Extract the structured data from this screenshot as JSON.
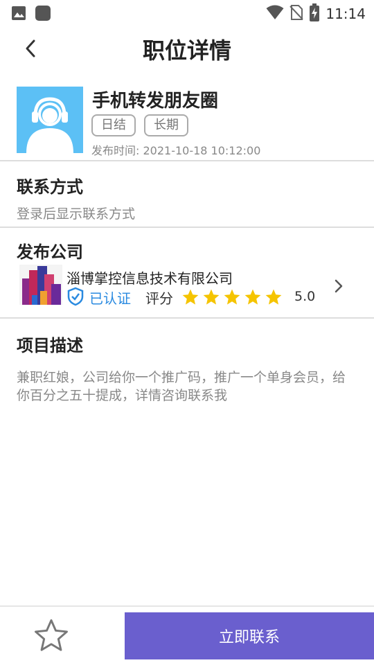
{
  "status_bar": {
    "time": "11:14",
    "icons": [
      "image-icon",
      "app-square-icon",
      "wifi-icon",
      "no-sim-icon",
      "battery-charging-icon"
    ]
  },
  "header": {
    "title": "职位详情",
    "back_icon": "chevron-left-icon"
  },
  "job": {
    "title": "手机转发朋友圈",
    "tags": [
      "日结",
      "长期"
    ],
    "publish_time": "发布时间: 2021-10-18 10:12:00",
    "avatar_icon": "headset-person-icon",
    "avatar_color": "#5cc0f5"
  },
  "contact": {
    "heading": "联系方式",
    "text": "登录后显示联系方式"
  },
  "company": {
    "heading": "发布公司",
    "name": "淄博掌控信息技术有限公司",
    "verified_label": "已认证",
    "rating_label": "评分",
    "rating_value": "5.0",
    "stars": 5,
    "star_color": "#f5c400",
    "verified_color": "#2a8ae0"
  },
  "description": {
    "heading": "项目描述",
    "text": "兼职红娘，公司给你一个推广码，推广一个单身会员，给你百分之五十提成，详情咨询联系我"
  },
  "bottom_bar": {
    "favorite_icon": "star-outline-icon",
    "contact_button": "立即联系",
    "button_color": "#6a5fce"
  }
}
